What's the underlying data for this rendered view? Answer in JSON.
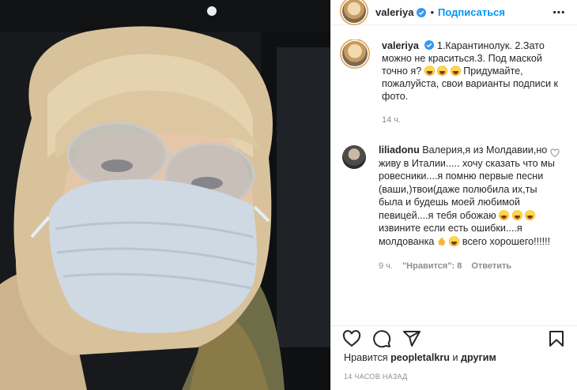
{
  "header": {
    "username": "valeriya",
    "separator": "•",
    "follow_label": "Подписаться",
    "more_icon": "more-horizontal-icon"
  },
  "caption": {
    "username": "valeriya",
    "text_1": "1.Карантинолук. 2.Зато можно не краситься.3. Под маской точно я?",
    "text_2": "Придумайте, пожалуйста, свои варианты подписи к фото.",
    "time": "14 ч."
  },
  "comment": {
    "username": "liliadonu",
    "text_1": "Валерия,я из Молдавии,но живу в Италии..... хочу сказать что мы ровесники....я помню первые песни (ваши,)твои(даже полюбила их,ты была и будешь моей любимой певицей....я тебя обожаю",
    "text_2": "извините если есть ошибки....я молдованка",
    "text_3": "всего хорошего!!!!!!",
    "time": "9 ч.",
    "likes_label": "\"Нравится\": 8",
    "reply_label": "Ответить"
  },
  "likes": {
    "prefix": "Нравится",
    "user": "peopletalkru",
    "connector": "и",
    "others": "другим"
  },
  "posted_ago": "14 часов назад",
  "colors": {
    "accent": "#0095f6",
    "muted": "#8e8e8e",
    "text": "#262626",
    "border": "#efefef"
  }
}
